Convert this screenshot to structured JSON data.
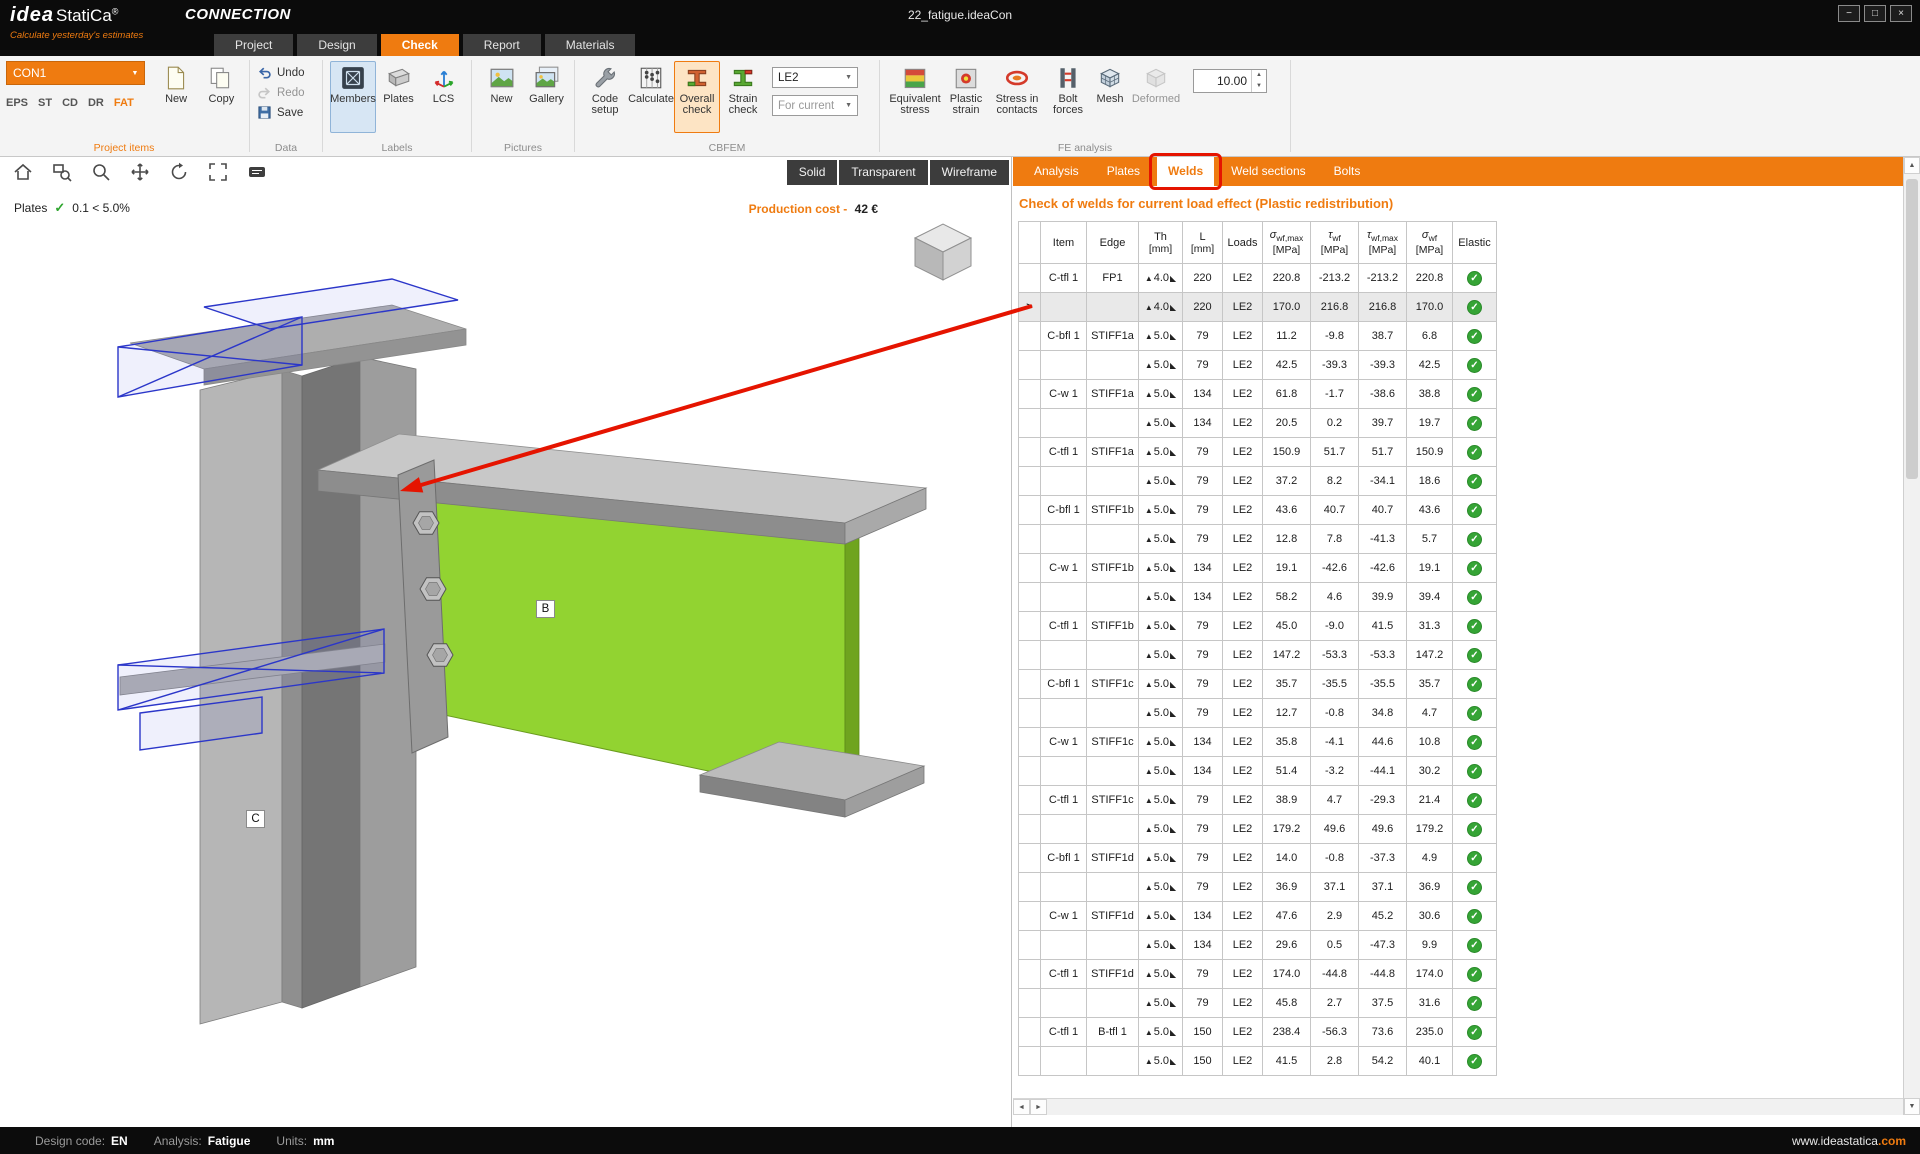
{
  "colors": {
    "accent": "#ef7b10",
    "annotation": "#e51400",
    "ok_green": "#35a435"
  },
  "titlebar": {
    "logo_idea": "idea",
    "logo_statica": "StatiCa",
    "logo_reg": "®",
    "tagline": "Calculate yesterday's estimates",
    "app_name": "CONNECTION",
    "document_title": "22_fatigue.ideaCon",
    "window": {
      "minimize": "−",
      "maximize": "□",
      "close": "×"
    }
  },
  "ribbon_tabs": [
    {
      "label": "Project"
    },
    {
      "label": "Design"
    },
    {
      "label": "Check"
    },
    {
      "label": "Report"
    },
    {
      "label": "Materials"
    }
  ],
  "ribbon": {
    "project_items": {
      "label": "Project items",
      "combo_value": "CON1",
      "modes": [
        "EPS",
        "ST",
        "CD",
        "DR",
        "FAT"
      ],
      "active_mode": "FAT",
      "new_label": "New",
      "copy_label": "Copy"
    },
    "data": {
      "label": "Data",
      "undo": "Undo",
      "redo": "Redo",
      "save": "Save"
    },
    "labels_group": {
      "label": "Labels",
      "members": "Members",
      "plates": "Plates",
      "lcs": "LCS"
    },
    "pictures": {
      "label": "Pictures",
      "new_label": "New",
      "gallery": "Gallery"
    },
    "cbfem": {
      "label": "CBFEM",
      "code_setup": "Code setup",
      "calculate": "Calculate",
      "overall_check": "Overall check",
      "strain_check": "Strain check",
      "load_effect_value": "LE2",
      "scope_value": "For current"
    },
    "fe_analysis": {
      "label": "FE analysis",
      "equivalent_stress": "Equivalent stress",
      "plastic_strain": "Plastic strain",
      "stress_in_contacts": "Stress in contacts",
      "bolt_forces": "Bolt forces",
      "mesh": "Mesh",
      "deformed": "Deformed",
      "scale_value": "10.00"
    }
  },
  "viewport": {
    "view_modes": [
      "Solid",
      "Transparent",
      "Wireframe"
    ],
    "plates_check": {
      "label": "Plates",
      "check": "✓",
      "value": "0.1 < 5.0%"
    },
    "production_cost": {
      "label": "Production cost -",
      "value": "42 €"
    },
    "member_labels": [
      "B",
      "C"
    ]
  },
  "results": {
    "tabs": [
      "Analysis",
      "Plates",
      "Welds",
      "Weld sections",
      "Bolts"
    ],
    "active_tab_index": 2,
    "title": "Check of welds for current load effect (Plastic redistribution)",
    "columns": [
      {
        "sym": "",
        "sub": "",
        "unit": ""
      },
      {
        "sym": "Item",
        "sub": "",
        "unit": ""
      },
      {
        "sym": "Edge",
        "sub": "",
        "unit": ""
      },
      {
        "sym": "Th",
        "sub": "",
        "unit": "[mm]"
      },
      {
        "sym": "L",
        "sub": "",
        "unit": "[mm]"
      },
      {
        "sym": "Loads",
        "sub": "",
        "unit": ""
      },
      {
        "sym": "σ",
        "sub": "wf,max",
        "unit": "[MPa]"
      },
      {
        "sym": "τ",
        "sub": "wf",
        "unit": "[MPa]"
      },
      {
        "sym": "τ",
        "sub": "wf,max",
        "unit": "[MPa]"
      },
      {
        "sym": "σ",
        "sub": "wf",
        "unit": "[MPa]"
      },
      {
        "sym": "Elastic",
        "sub": "",
        "unit": ""
      }
    ],
    "rows": [
      {
        "item": "C-tfl 1",
        "edge": "FP1",
        "th": "4.0",
        "l": "220",
        "loads": "LE2",
        "smax": "220.8",
        "t": "-213.2",
        "tmax": "-213.2",
        "s": "220.8",
        "ok": true
      },
      {
        "sel": true,
        "item": "",
        "edge": "",
        "th": "4.0",
        "l": "220",
        "loads": "LE2",
        "smax": "170.0",
        "t": "216.8",
        "tmax": "216.8",
        "s": "170.0",
        "ok": true
      },
      {
        "item": "C-bfl 1",
        "edge": "STIFF1a",
        "th": "5.0",
        "l": "79",
        "loads": "LE2",
        "smax": "11.2",
        "t": "-9.8",
        "tmax": "38.7",
        "s": "6.8",
        "ok": true
      },
      {
        "item": "",
        "edge": "",
        "th": "5.0",
        "l": "79",
        "loads": "LE2",
        "smax": "42.5",
        "t": "-39.3",
        "tmax": "-39.3",
        "s": "42.5",
        "ok": true
      },
      {
        "item": "C-w 1",
        "edge": "STIFF1a",
        "th": "5.0",
        "l": "134",
        "loads": "LE2",
        "smax": "61.8",
        "t": "-1.7",
        "tmax": "-38.6",
        "s": "38.8",
        "ok": true
      },
      {
        "item": "",
        "edge": "",
        "th": "5.0",
        "l": "134",
        "loads": "LE2",
        "smax": "20.5",
        "t": "0.2",
        "tmax": "39.7",
        "s": "19.7",
        "ok": true
      },
      {
        "item": "C-tfl 1",
        "edge": "STIFF1a",
        "th": "5.0",
        "l": "79",
        "loads": "LE2",
        "smax": "150.9",
        "t": "51.7",
        "tmax": "51.7",
        "s": "150.9",
        "ok": true
      },
      {
        "item": "",
        "edge": "",
        "th": "5.0",
        "l": "79",
        "loads": "LE2",
        "smax": "37.2",
        "t": "8.2",
        "tmax": "-34.1",
        "s": "18.6",
        "ok": true
      },
      {
        "item": "C-bfl 1",
        "edge": "STIFF1b",
        "th": "5.0",
        "l": "79",
        "loads": "LE2",
        "smax": "43.6",
        "t": "40.7",
        "tmax": "40.7",
        "s": "43.6",
        "ok": true
      },
      {
        "item": "",
        "edge": "",
        "th": "5.0",
        "l": "79",
        "loads": "LE2",
        "smax": "12.8",
        "t": "7.8",
        "tmax": "-41.3",
        "s": "5.7",
        "ok": true
      },
      {
        "item": "C-w 1",
        "edge": "STIFF1b",
        "th": "5.0",
        "l": "134",
        "loads": "LE2",
        "smax": "19.1",
        "t": "-42.6",
        "tmax": "-42.6",
        "s": "19.1",
        "ok": true
      },
      {
        "item": "",
        "edge": "",
        "th": "5.0",
        "l": "134",
        "loads": "LE2",
        "smax": "58.2",
        "t": "4.6",
        "tmax": "39.9",
        "s": "39.4",
        "ok": true
      },
      {
        "item": "C-tfl 1",
        "edge": "STIFF1b",
        "th": "5.0",
        "l": "79",
        "loads": "LE2",
        "smax": "45.0",
        "t": "-9.0",
        "tmax": "41.5",
        "s": "31.3",
        "ok": true
      },
      {
        "item": "",
        "edge": "",
        "th": "5.0",
        "l": "79",
        "loads": "LE2",
        "smax": "147.2",
        "t": "-53.3",
        "tmax": "-53.3",
        "s": "147.2",
        "ok": true
      },
      {
        "item": "C-bfl 1",
        "edge": "STIFF1c",
        "th": "5.0",
        "l": "79",
        "loads": "LE2",
        "smax": "35.7",
        "t": "-35.5",
        "tmax": "-35.5",
        "s": "35.7",
        "ok": true
      },
      {
        "item": "",
        "edge": "",
        "th": "5.0",
        "l": "79",
        "loads": "LE2",
        "smax": "12.7",
        "t": "-0.8",
        "tmax": "34.8",
        "s": "4.7",
        "ok": true
      },
      {
        "item": "C-w 1",
        "edge": "STIFF1c",
        "th": "5.0",
        "l": "134",
        "loads": "LE2",
        "smax": "35.8",
        "t": "-4.1",
        "tmax": "44.6",
        "s": "10.8",
        "ok": true
      },
      {
        "item": "",
        "edge": "",
        "th": "5.0",
        "l": "134",
        "loads": "LE2",
        "smax": "51.4",
        "t": "-3.2",
        "tmax": "-44.1",
        "s": "30.2",
        "ok": true
      },
      {
        "item": "C-tfl 1",
        "edge": "STIFF1c",
        "th": "5.0",
        "l": "79",
        "loads": "LE2",
        "smax": "38.9",
        "t": "4.7",
        "tmax": "-29.3",
        "s": "21.4",
        "ok": true
      },
      {
        "item": "",
        "edge": "",
        "th": "5.0",
        "l": "79",
        "loads": "LE2",
        "smax": "179.2",
        "t": "49.6",
        "tmax": "49.6",
        "s": "179.2",
        "ok": true
      },
      {
        "item": "C-bfl 1",
        "edge": "STIFF1d",
        "th": "5.0",
        "l": "79",
        "loads": "LE2",
        "smax": "14.0",
        "t": "-0.8",
        "tmax": "-37.3",
        "s": "4.9",
        "ok": true
      },
      {
        "item": "",
        "edge": "",
        "th": "5.0",
        "l": "79",
        "loads": "LE2",
        "smax": "36.9",
        "t": "37.1",
        "tmax": "37.1",
        "s": "36.9",
        "ok": true
      },
      {
        "item": "C-w 1",
        "edge": "STIFF1d",
        "th": "5.0",
        "l": "134",
        "loads": "LE2",
        "smax": "47.6",
        "t": "2.9",
        "tmax": "45.2",
        "s": "30.6",
        "ok": true
      },
      {
        "item": "",
        "edge": "",
        "th": "5.0",
        "l": "134",
        "loads": "LE2",
        "smax": "29.6",
        "t": "0.5",
        "tmax": "-47.3",
        "s": "9.9",
        "ok": true
      },
      {
        "item": "C-tfl 1",
        "edge": "STIFF1d",
        "th": "5.0",
        "l": "79",
        "loads": "LE2",
        "smax": "174.0",
        "t": "-44.8",
        "tmax": "-44.8",
        "s": "174.0",
        "ok": true
      },
      {
        "item": "",
        "edge": "",
        "th": "5.0",
        "l": "79",
        "loads": "LE2",
        "smax": "45.8",
        "t": "2.7",
        "tmax": "37.5",
        "s": "31.6",
        "ok": true
      },
      {
        "item": "C-tfl 1",
        "edge": "B-tfl 1",
        "th": "5.0",
        "l": "150",
        "loads": "LE2",
        "smax": "238.4",
        "t": "-56.3",
        "tmax": "73.6",
        "s": "235.0",
        "ok": true
      },
      {
        "item": "",
        "edge": "",
        "th": "5.0",
        "l": "150",
        "loads": "LE2",
        "smax": "41.5",
        "t": "2.8",
        "tmax": "54.2",
        "s": "40.1",
        "ok": true
      }
    ]
  },
  "statusbar": {
    "design_code_label": "Design code:",
    "design_code": "EN",
    "analysis_label": "Analysis:",
    "analysis": "Fatigue",
    "units_label": "Units:",
    "units": "mm",
    "website_main": "www.ideastatica",
    "website_tld": ".com"
  },
  "icons": {
    "dropdown": "▼",
    "check": "✓",
    "row_marker": ">",
    "weld_left": "▲",
    "weld_right": "◣",
    "spin_up": "▲",
    "spin_down": "▼",
    "scroll_up": "▲",
    "scroll_down": "▼",
    "scroll_left": "◄",
    "scroll_right": "►"
  }
}
